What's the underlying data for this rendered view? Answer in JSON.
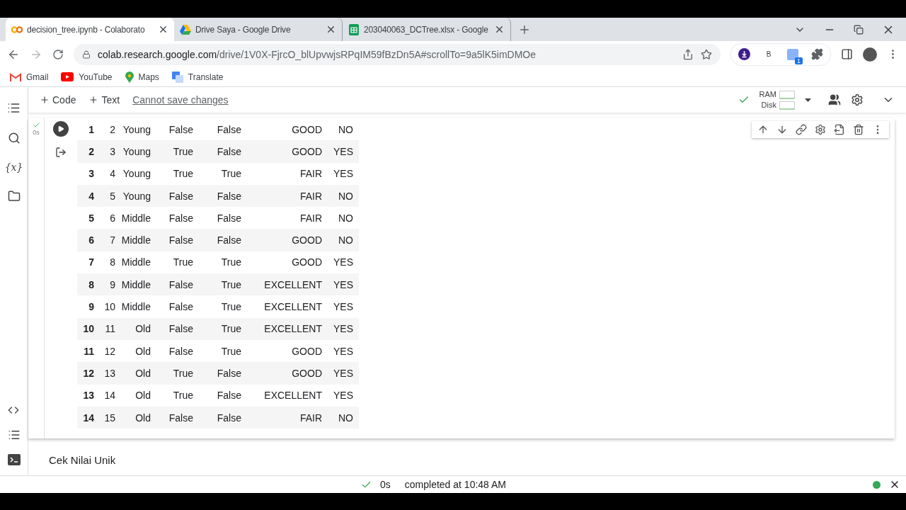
{
  "browser_tabs": [
    {
      "title": "decision_tree.ipynb - Colaborato",
      "kind": "colab",
      "selected": true
    },
    {
      "title": "Drive Saya - Google Drive",
      "kind": "drive",
      "selected": false
    },
    {
      "title": "203040063_DCTree.xlsx - Google",
      "kind": "sheets",
      "selected": false
    }
  ],
  "address": {
    "host": "colab.research.google.com",
    "path": "/drive/1V0X-FjrcO_blUpvwjsRPqIM59fBzDn5A#scrollTo=9a5lK5imDMOe"
  },
  "extensions": {
    "letter": "B",
    "badge": "1"
  },
  "bookmarks": [
    {
      "label": "Gmail",
      "kind": "gmail"
    },
    {
      "label": "YouTube",
      "kind": "youtube"
    },
    {
      "label": "Maps",
      "kind": "maps"
    },
    {
      "label": "Translate",
      "kind": "translate"
    }
  ],
  "toolbar": {
    "add_code": "Code",
    "add_text": "Text",
    "save_notice": "Cannot save changes",
    "ram": "RAM",
    "disk": "Disk"
  },
  "cell": {
    "exec_time": "0s",
    "rows": [
      [
        "1",
        "2",
        "Young",
        "False",
        "False",
        "GOOD",
        "NO"
      ],
      [
        "2",
        "3",
        "Young",
        "True",
        "False",
        "GOOD",
        "YES"
      ],
      [
        "3",
        "4",
        "Young",
        "True",
        "True",
        "FAIR",
        "YES"
      ],
      [
        "4",
        "5",
        "Young",
        "False",
        "False",
        "FAIR",
        "NO"
      ],
      [
        "5",
        "6",
        "Middle",
        "False",
        "False",
        "FAIR",
        "NO"
      ],
      [
        "6",
        "7",
        "Middle",
        "False",
        "False",
        "GOOD",
        "NO"
      ],
      [
        "7",
        "8",
        "Middle",
        "True",
        "True",
        "GOOD",
        "YES"
      ],
      [
        "8",
        "9",
        "Middle",
        "False",
        "True",
        "EXCELLENT",
        "YES"
      ],
      [
        "9",
        "10",
        "Middle",
        "False",
        "True",
        "EXCELLENT",
        "YES"
      ],
      [
        "10",
        "11",
        "Old",
        "False",
        "True",
        "EXCELLENT",
        "YES"
      ],
      [
        "11",
        "12",
        "Old",
        "False",
        "True",
        "GOOD",
        "YES"
      ],
      [
        "12",
        "13",
        "Old",
        "True",
        "False",
        "GOOD",
        "YES"
      ],
      [
        "13",
        "14",
        "Old",
        "True",
        "False",
        "EXCELLENT",
        "YES"
      ],
      [
        "14",
        "15",
        "Old",
        "False",
        "False",
        "FAIR",
        "NO"
      ]
    ]
  },
  "rail": {
    "variables": "{x}"
  },
  "text_cell": "Cek Nilai Unik",
  "status_bar": {
    "time": "0s",
    "message": "completed at 10:48 AM"
  }
}
